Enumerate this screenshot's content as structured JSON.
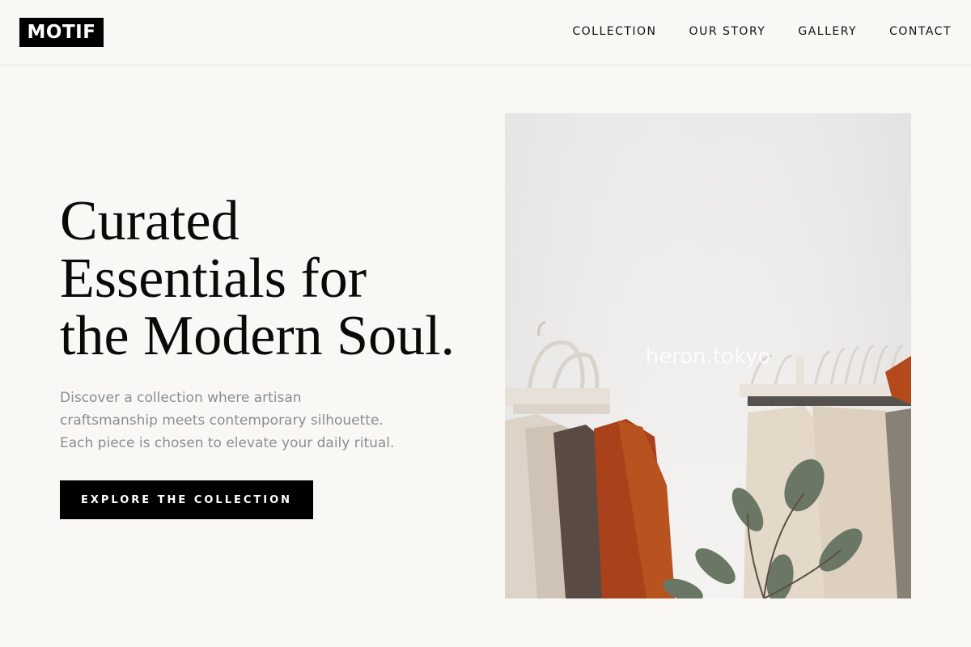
{
  "brand": {
    "logo_text": "MOTIF"
  },
  "nav": {
    "items": [
      {
        "label": "COLLECTION"
      },
      {
        "label": "OUR STORY"
      },
      {
        "label": "GALLERY"
      },
      {
        "label": "CONTACT"
      }
    ]
  },
  "hero": {
    "title_lines": [
      "Curated",
      "Essentials for",
      "the Modern Soul."
    ],
    "description_lines": [
      "Discover a collection where artisan",
      "craftsmanship meets contemporary silhouette.",
      "Each piece is chosen to elevate your daily ritual."
    ],
    "cta_label": "EXPLORE THE COLLECTION",
    "image": {
      "watermark": "heron.tokyo",
      "subject": "clothing-rack-photo"
    }
  },
  "colors": {
    "background": "#f9f8f5",
    "text": "#111111",
    "muted_text": "#8a8d90",
    "button_bg": "#000000",
    "button_text": "#ffffff"
  }
}
